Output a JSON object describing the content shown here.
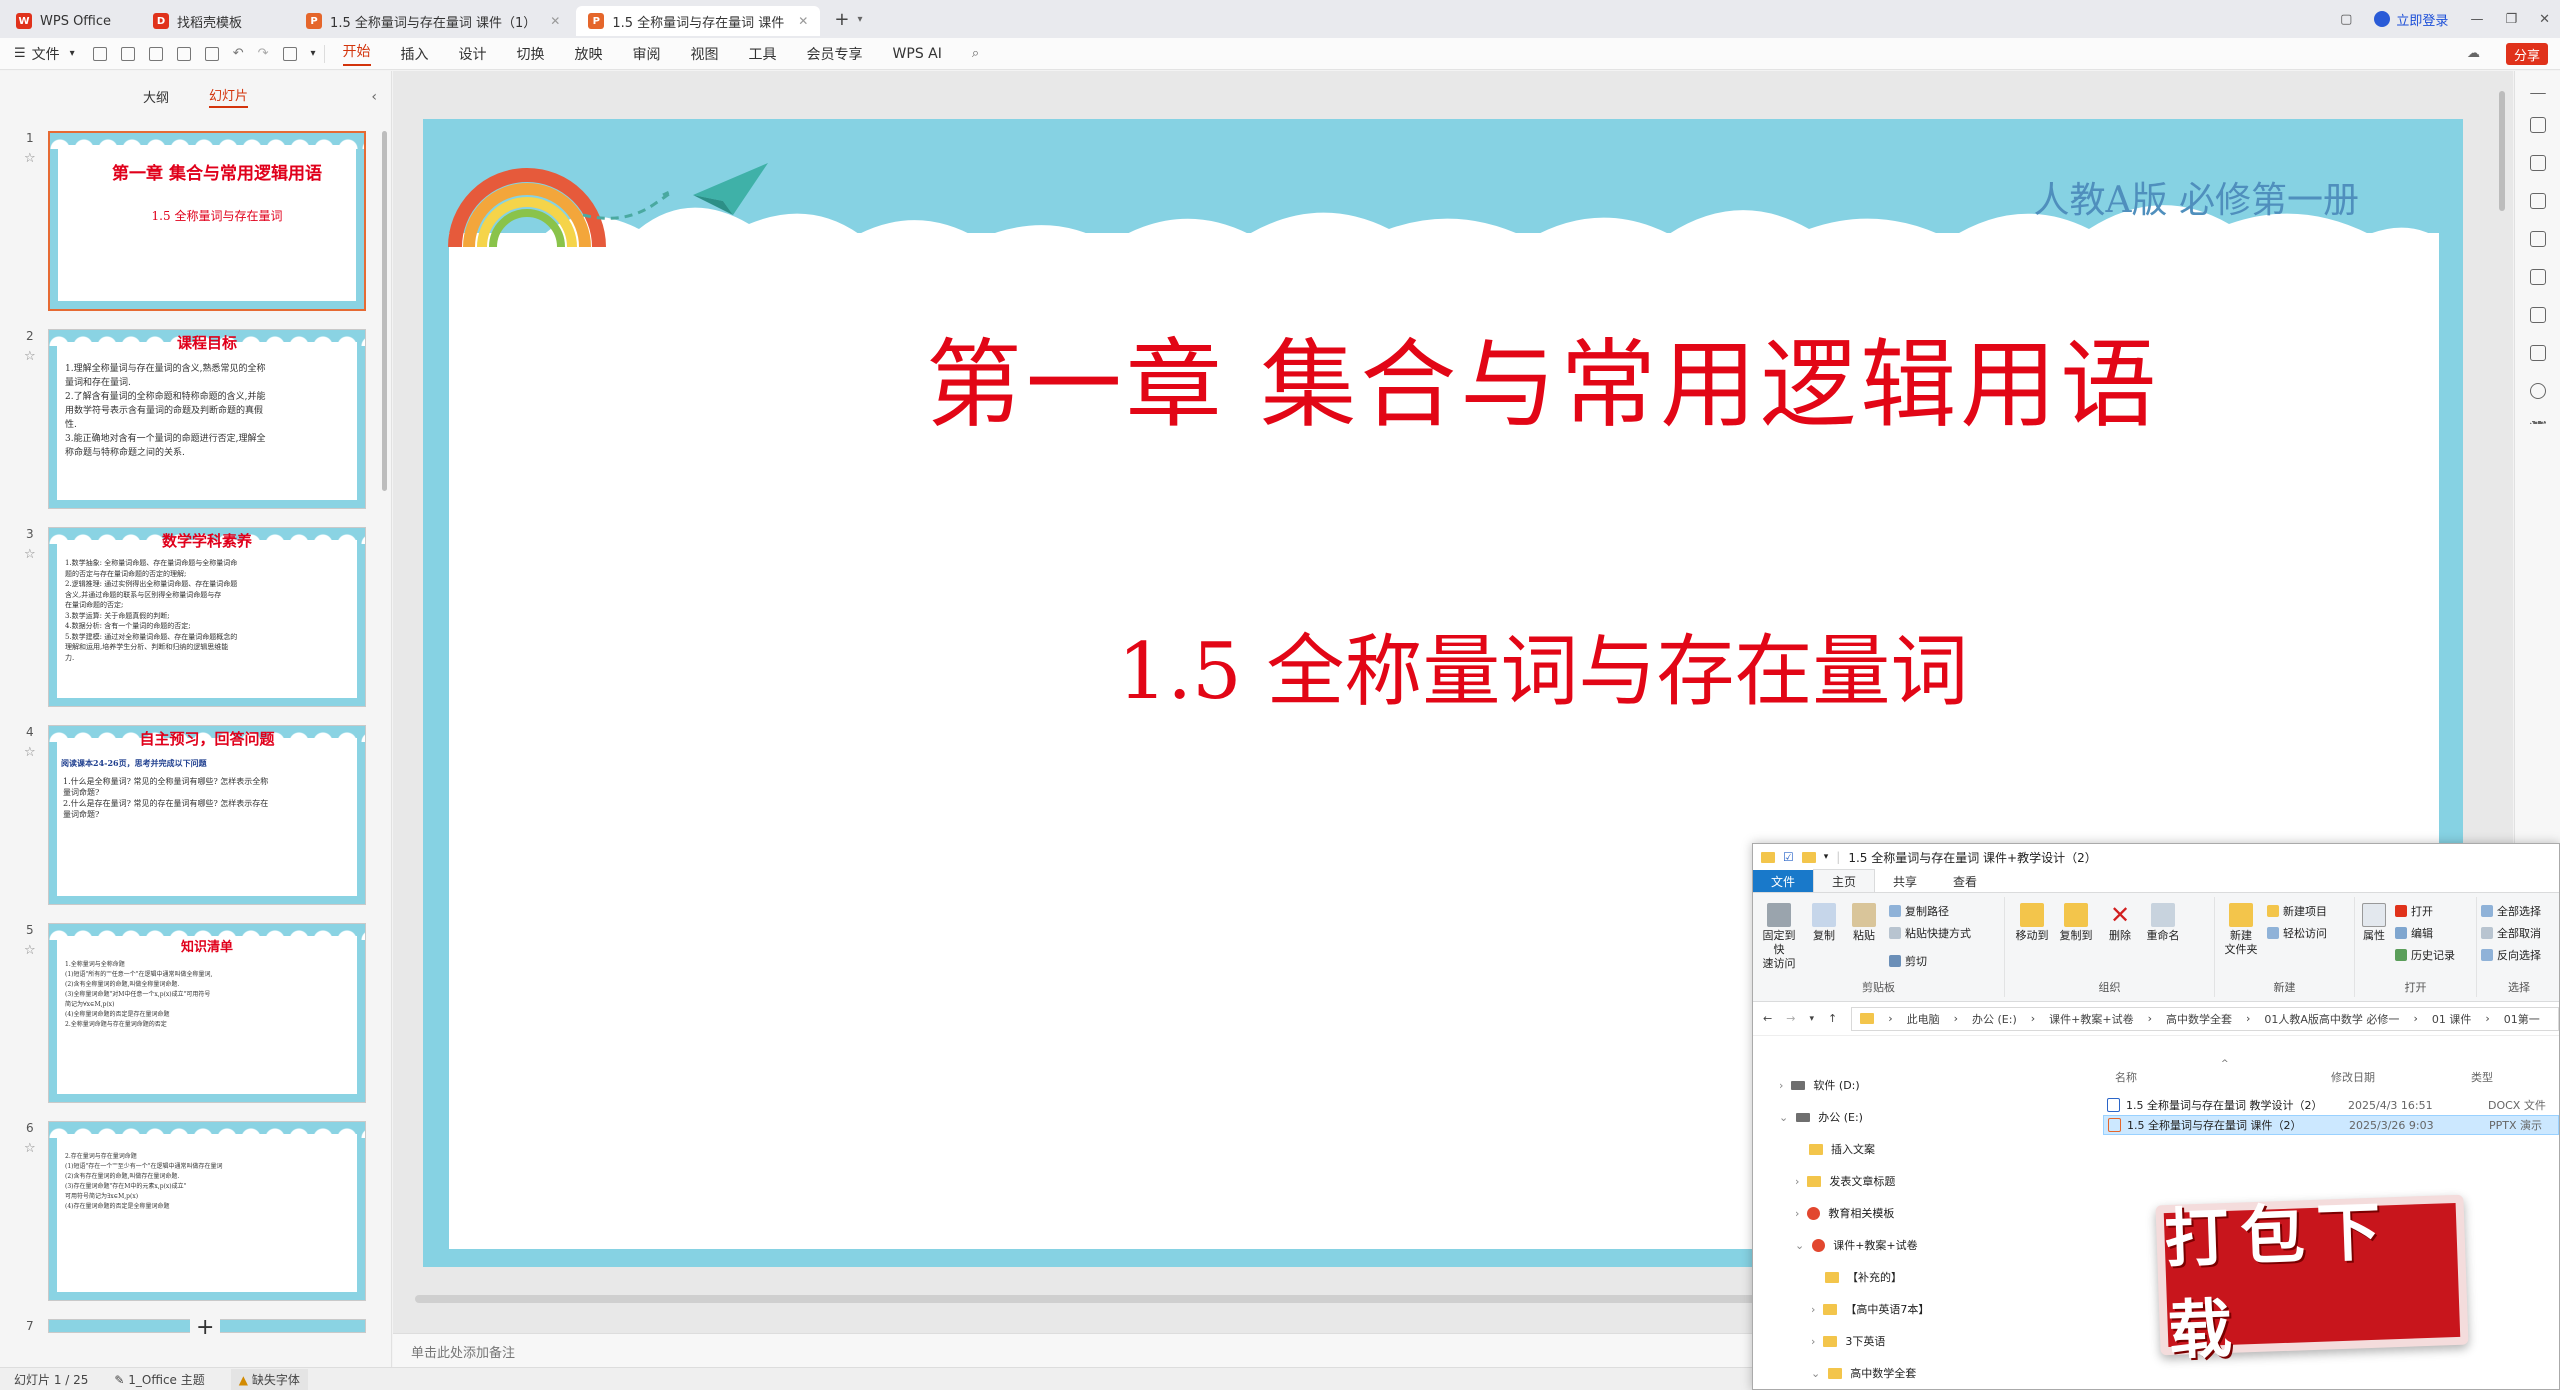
{
  "tabs": [
    {
      "label": "WPS Office",
      "icon": "wps-logo-icon",
      "color": "#e0321b"
    },
    {
      "label": "找稻壳模板",
      "icon": "docer-icon",
      "color": "#e0321b"
    },
    {
      "label": "1.5 全称量词与存在量词  课件（1）",
      "icon": "ppt-icon",
      "color": "#e5662b"
    },
    {
      "label": "1.5 全称量词与存在量词  课件",
      "icon": "ppt-icon",
      "color": "#e5662b"
    }
  ],
  "titlebar": {
    "login": "立即登录"
  },
  "menu": {
    "file": "文件",
    "items": [
      "开始",
      "插入",
      "设计",
      "切换",
      "放映",
      "审阅",
      "视图",
      "工具",
      "会员专享",
      "WPS AI"
    ],
    "active": "开始",
    "share": "分享"
  },
  "left_panel": {
    "tab_outline": "大纲",
    "tab_slides": "幻灯片",
    "thumbs": [
      {
        "num": "1",
        "title": "第一章  集合与常用逻辑用语",
        "sub": "1.5    全称量词与存在量词",
        "body": ""
      },
      {
        "num": "2",
        "title": "课程目标",
        "sub": "",
        "body": "1.理解全称量词与存在量词的含义,熟悉常见的全称\n量词和存在量词.\n2.了解含有量词的全称命题和特称命题的含义,并能\n用数学符号表示含有量词的命题及判断命题的真假\n性.\n3.能正确地对含有一个量词的命题进行否定,理解全\n称命题与特称命题之间的关系."
      },
      {
        "num": "3",
        "title": "数学学科素养",
        "sub": "",
        "body": "1.数学抽象: 全称量词命题、存在量词命题与全称量词命\n题的否定与存在量词命题的否定的理解;\n2.逻辑推理: 通过实例得出全称量词命题、存在量词命题\n含义,并通过命题的联系与区别得全称量词命题与存\n在量词命题的否定;\n3.数学运算: 关于命题真假的判断;\n4.数据分析: 含有一个量词的命题的否定;\n5.数学建模: 通过对全称量词命题、存在量词命题概念的\n理解和运用,培养学生分析、判断和归纳的逻辑思维能\n力."
      },
      {
        "num": "4",
        "title": "自主预习，回答问题",
        "sub": "阅读课本24-26页，思考并完成以下问题",
        "body": "1.什么是全称量词? 常见的全称量词有哪些? 怎样表示全称\n量词命题?\n2.什么是存在量词? 常见的存在量词有哪些? 怎样表示存在\n量词命题?"
      },
      {
        "num": "5",
        "title": "知识清单",
        "sub": "",
        "body": "1.全称量词与全称命题\n(1)短语\"所有的\"\"任意一个\"在逻辑中通常叫做全称量词,\n(2)含有全称量词的命题,叫做全称量词命题.\n(3)全称量词命题\"对M中任意一个x,p(x)成立\"可用符号\n简记为∀x∈M,p(x)\n(4)全称量词命题的否定是存在量词命题\n2.全称量词命题与存在量词命题的否定"
      },
      {
        "num": "6",
        "title": "",
        "sub": "",
        "body": "2.存在量词与存在量词命题\n(1)短语\"存在一个\"\"至少有一个\"在逻辑中通常叫做存在量词\n(2)含有存在量词的命题,叫做存在量词命题.\n(3)存在量词命题\"存在M中的元素x,p(x)成立\"\n可用符号简记为∃x∈M,p(x)\n(4)存在量词命题的否定是全称量词命题"
      },
      {
        "num": "7",
        "title": "",
        "sub": "",
        "body": ""
      }
    ]
  },
  "slide": {
    "corner": "人教A版  必修第一册",
    "chapter": "第一章  集合与常用逻辑用语",
    "lesson": "1.5    全称量词与存在量词"
  },
  "notes_placeholder": "单击此处添加备注",
  "status": {
    "slide_count": "幻灯片 1 / 25",
    "theme": "1_Office 主题",
    "missing_font": "缺失字体"
  },
  "explorer": {
    "title": "1.5 全称量词与存在量词 课件+教学设计（2）",
    "ribbon_tabs": [
      "文件",
      "主页",
      "共享",
      "查看"
    ],
    "groups": {
      "clipboard": "剪贴板",
      "organize": "组织",
      "new": "新建",
      "open": "打开",
      "select": "选择"
    },
    "buttons": {
      "pin": "固定到快\n速访问",
      "copy": "复制",
      "paste": "粘贴",
      "copy_path": "复制路径",
      "paste_shortcut": "粘贴快捷方式",
      "cut": "剪切",
      "move_to": "移动到",
      "copy_to": "复制到",
      "delete": "删除",
      "rename": "重命名",
      "new_folder": "新建\n文件夹",
      "new_item": "新建项目",
      "easy_access": "轻松访问",
      "properties": "属性",
      "open": "打开",
      "edit": "编辑",
      "history": "历史记录",
      "select_all": "全部选择",
      "select_none": "全部取消",
      "invert": "反向选择"
    },
    "breadcrumb": [
      "此电脑",
      "办公 (E:)",
      "课件+教案+试卷",
      "高中数学全套",
      "01人教A版高中数学 必修一",
      "01 课件",
      "01第一"
    ],
    "nav": [
      {
        "label": "软件 (D:)",
        "kind": "drive",
        "level": 0
      },
      {
        "label": "办公 (E:)",
        "kind": "drive",
        "level": 0
      },
      {
        "label": "插入文案",
        "kind": "folder",
        "level": 1
      },
      {
        "label": "发表文章标题",
        "kind": "folder",
        "level": 1
      },
      {
        "label": "教育相关模板",
        "kind": "red",
        "level": 1
      },
      {
        "label": "课件+教案+试卷",
        "kind": "red",
        "level": 1
      },
      {
        "label": "【补充的】",
        "kind": "folder",
        "level": 2
      },
      {
        "label": "【高中英语7本】",
        "kind": "folder",
        "level": 2
      },
      {
        "label": "3下英语",
        "kind": "folder",
        "level": 2
      },
      {
        "label": "高中数学全套",
        "kind": "folder",
        "level": 2
      }
    ],
    "columns": {
      "name": "名称",
      "date": "修改日期",
      "type": "类型"
    },
    "files": [
      {
        "name": "1.5 全称量词与存在量词 教学设计（2）",
        "date": "2025/4/3 16:51",
        "type": "DOCX 文件",
        "icon_color": "#2b65c8"
      },
      {
        "name": "1.5 全称量词与存在量词 课件（2）",
        "date": "2025/3/26 9:03",
        "type": "PPTX 演示",
        "icon_color": "#e5662b"
      }
    ]
  },
  "badge": {
    "text": "打包下载"
  }
}
